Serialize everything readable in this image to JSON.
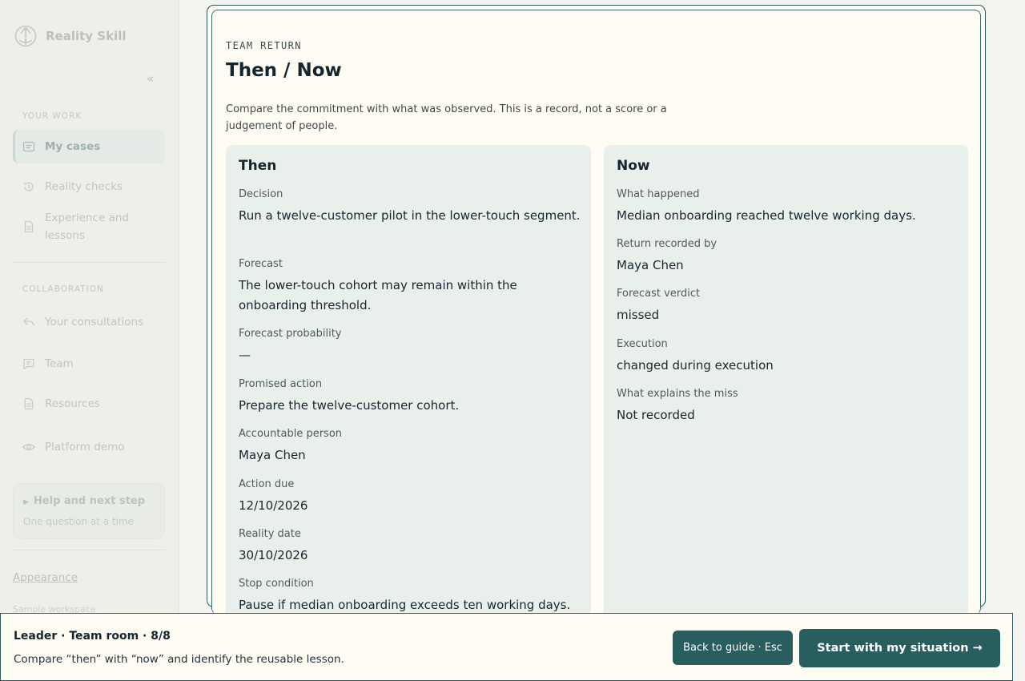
{
  "sidebar": {
    "brand": "Reality Skill",
    "collapse_glyph": "«",
    "sections": {
      "work": "YOUR WORK",
      "collab": "COLLABORATION"
    },
    "items": [
      {
        "label": "My cases",
        "icon": "case-icon",
        "active": true
      },
      {
        "label": "Reality checks",
        "icon": "history-icon"
      },
      {
        "label": "Experience and lessons",
        "icon": "document-icon"
      },
      {
        "label": "Your consultations",
        "icon": "reply-icon"
      },
      {
        "label": "Team",
        "icon": "chat-icon"
      },
      {
        "label": "Resources",
        "icon": "document-icon"
      },
      {
        "label": "Platform demo",
        "icon": "eye-icon"
      }
    ],
    "help": {
      "title": "Help and next step",
      "subtitle": "One question at a time",
      "glyph": "▶"
    },
    "appearance": "Appearance",
    "sample": "Sample workspace"
  },
  "card": {
    "eyebrow": "TEAM RETURN",
    "title": "Then / Now",
    "description": "Compare the commitment with what was observed. This is a record, not a score or a judgement of people.",
    "then": {
      "heading": "Then",
      "fields": [
        {
          "label": "Decision",
          "value": "Run a twelve-customer pilot in the lower-touch segment."
        },
        {
          "label": "Forecast",
          "value": "The lower-touch cohort may remain within the onboarding threshold."
        },
        {
          "label": "Forecast probability",
          "value": "—"
        },
        {
          "label": "Promised action",
          "value": "Prepare the twelve-customer cohort."
        },
        {
          "label": "Accountable person",
          "value": "Maya Chen"
        },
        {
          "label": "Action due",
          "value": "12/10/2026"
        },
        {
          "label": "Reality date",
          "value": "30/10/2026"
        },
        {
          "label": "Stop condition",
          "value": "Pause if median onboarding exceeds ten working days."
        }
      ]
    },
    "now": {
      "heading": "Now",
      "fields": [
        {
          "label": "What happened",
          "value": "Median onboarding reached twelve working days."
        },
        {
          "label": "Return recorded by",
          "value": "Maya Chen"
        },
        {
          "label": "Forecast verdict",
          "value": "missed"
        },
        {
          "label": "Execution",
          "value": "changed during execution"
        },
        {
          "label": "What explains the miss",
          "value": "Not recorded"
        }
      ]
    }
  },
  "bottom": {
    "title": "Leader · Team room · 8/8",
    "subtitle": "Compare “then” with “now” and identify the reusable lesson.",
    "back_label": "Back to guide · Esc",
    "start_label": "Start with my situation →"
  },
  "colors": {
    "accent": "#285e5d",
    "card_bg": "#fffcf4",
    "column_bg": "#e9f0ec"
  }
}
